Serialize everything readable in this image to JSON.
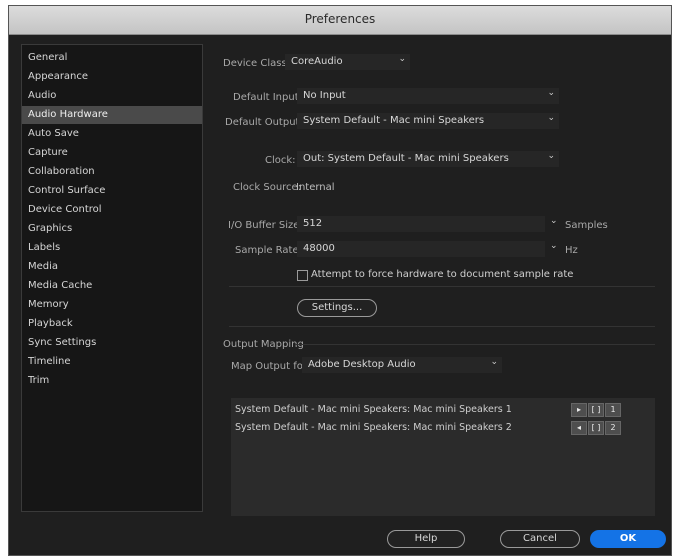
{
  "window": {
    "title": "Preferences"
  },
  "sidebar": {
    "items": [
      {
        "label": "General"
      },
      {
        "label": "Appearance"
      },
      {
        "label": "Audio"
      },
      {
        "label": "Audio Hardware"
      },
      {
        "label": "Auto Save"
      },
      {
        "label": "Capture"
      },
      {
        "label": "Collaboration"
      },
      {
        "label": "Control Surface"
      },
      {
        "label": "Device Control"
      },
      {
        "label": "Graphics"
      },
      {
        "label": "Labels"
      },
      {
        "label": "Media"
      },
      {
        "label": "Media Cache"
      },
      {
        "label": "Memory"
      },
      {
        "label": "Playback"
      },
      {
        "label": "Sync Settings"
      },
      {
        "label": "Timeline"
      },
      {
        "label": "Trim"
      }
    ],
    "selected": "Audio Hardware"
  },
  "hardware": {
    "device_class_label": "Device Class:",
    "device_class_value": "CoreAudio",
    "default_input_label": "Default Input:",
    "default_input_value": "No Input",
    "default_output_label": "Default Output:",
    "default_output_value": "System Default - Mac mini Speakers",
    "clock_label": "Clock:",
    "clock_value": "Out: System Default - Mac mini Speakers",
    "clock_source_label": "Clock Source:",
    "clock_source_value": "Internal",
    "buffer_label": "I/O Buffer Size:",
    "buffer_value": "512",
    "buffer_unit": "Samples",
    "sample_rate_label": "Sample Rate:",
    "sample_rate_value": "48000",
    "sample_rate_unit": "Hz",
    "force_rate_label": "Attempt to force hardware to document sample rate",
    "settings_label": "Settings..."
  },
  "output_mapping": {
    "section_label": "Output Mapping",
    "map_for_label": "Map Output for:",
    "map_for_value": "Adobe Desktop Audio",
    "rows": [
      {
        "label": "System Default - Mac mini Speakers: Mac mini Speakers 1",
        "channel": "1",
        "icon_a": "▸"
      },
      {
        "label": "System Default - Mac mini Speakers: Mac mini Speakers 2",
        "channel": "2",
        "icon_a": "◂"
      }
    ]
  },
  "footer": {
    "help_label": "Help",
    "cancel_label": "Cancel",
    "ok_label": "OK"
  },
  "colors": {
    "accent": "#1473e6",
    "background": "#1f1f1f",
    "selected_row": "#4a4a4a"
  }
}
